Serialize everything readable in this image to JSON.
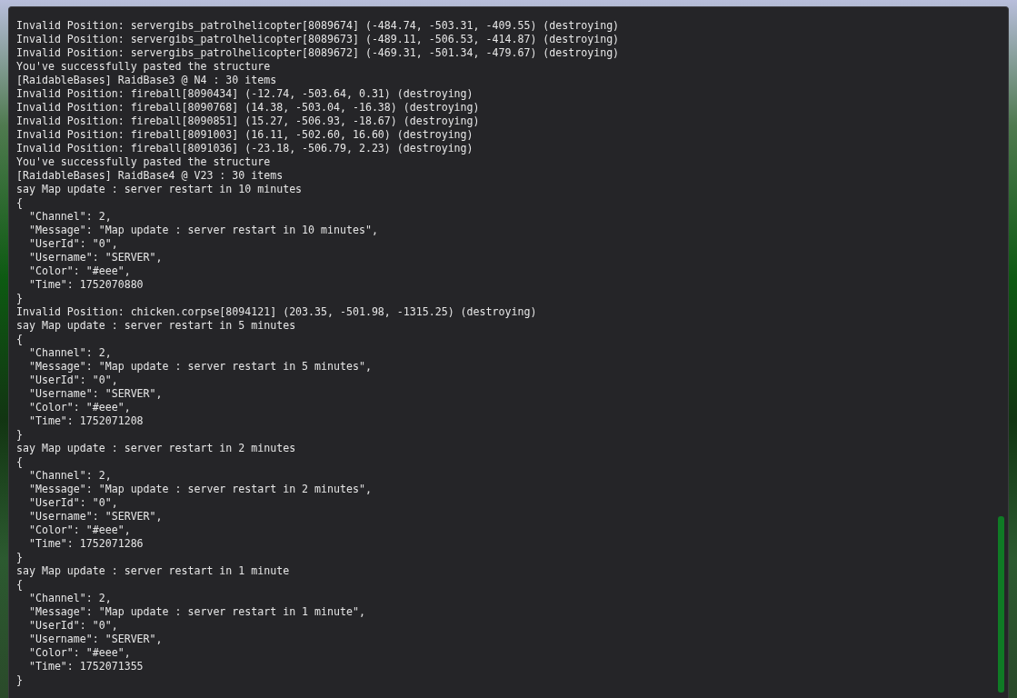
{
  "console": {
    "lines": [
      "Invalid Position: servergibs_patrolhelicopter[8089674] (-484.74, -503.31, -409.55) (destroying)",
      "Invalid Position: servergibs_patrolhelicopter[8089673] (-489.11, -506.53, -414.87) (destroying)",
      "Invalid Position: servergibs_patrolhelicopter[8089672] (-469.31, -501.34, -479.67) (destroying)",
      "You've successfully pasted the structure",
      "[RaidableBases] RaidBase3 @ N4 : 30 items",
      "Invalid Position: fireball[8090434] (-12.74, -503.64, 0.31) (destroying)",
      "Invalid Position: fireball[8090768] (14.38, -503.04, -16.38) (destroying)",
      "Invalid Position: fireball[8090851] (15.27, -506.93, -18.67) (destroying)",
      "Invalid Position: fireball[8091003] (16.11, -502.60, 16.60) (destroying)",
      "Invalid Position: fireball[8091036] (-23.18, -506.79, 2.23) (destroying)",
      "You've successfully pasted the structure",
      "[RaidableBases] RaidBase4 @ V23 : 30 items",
      "say Map update : server restart in 10 minutes",
      "{",
      "  \"Channel\": 2,",
      "  \"Message\": \"Map update : server restart in 10 minutes\",",
      "  \"UserId\": \"0\",",
      "  \"Username\": \"SERVER\",",
      "  \"Color\": \"#eee\",",
      "  \"Time\": 1752070880",
      "}",
      "Invalid Position: chicken.corpse[8094121] (203.35, -501.98, -1315.25) (destroying)",
      "say Map update : server restart in 5 minutes",
      "{",
      "  \"Channel\": 2,",
      "  \"Message\": \"Map update : server restart in 5 minutes\",",
      "  \"UserId\": \"0\",",
      "  \"Username\": \"SERVER\",",
      "  \"Color\": \"#eee\",",
      "  \"Time\": 1752071208",
      "}",
      "say Map update : server restart in 2 minutes",
      "{",
      "  \"Channel\": 2,",
      "  \"Message\": \"Map update : server restart in 2 minutes\",",
      "  \"UserId\": \"0\",",
      "  \"Username\": \"SERVER\",",
      "  \"Color\": \"#eee\",",
      "  \"Time\": 1752071286",
      "}",
      "say Map update : server restart in 1 minute",
      "{",
      "  \"Channel\": 2,",
      "  \"Message\": \"Map update : server restart in 1 minute\",",
      "  \"UserId\": \"0\",",
      "  \"Username\": \"SERVER\",",
      "  \"Color\": \"#eee\",",
      "  \"Time\": 1752071355",
      "}"
    ]
  }
}
